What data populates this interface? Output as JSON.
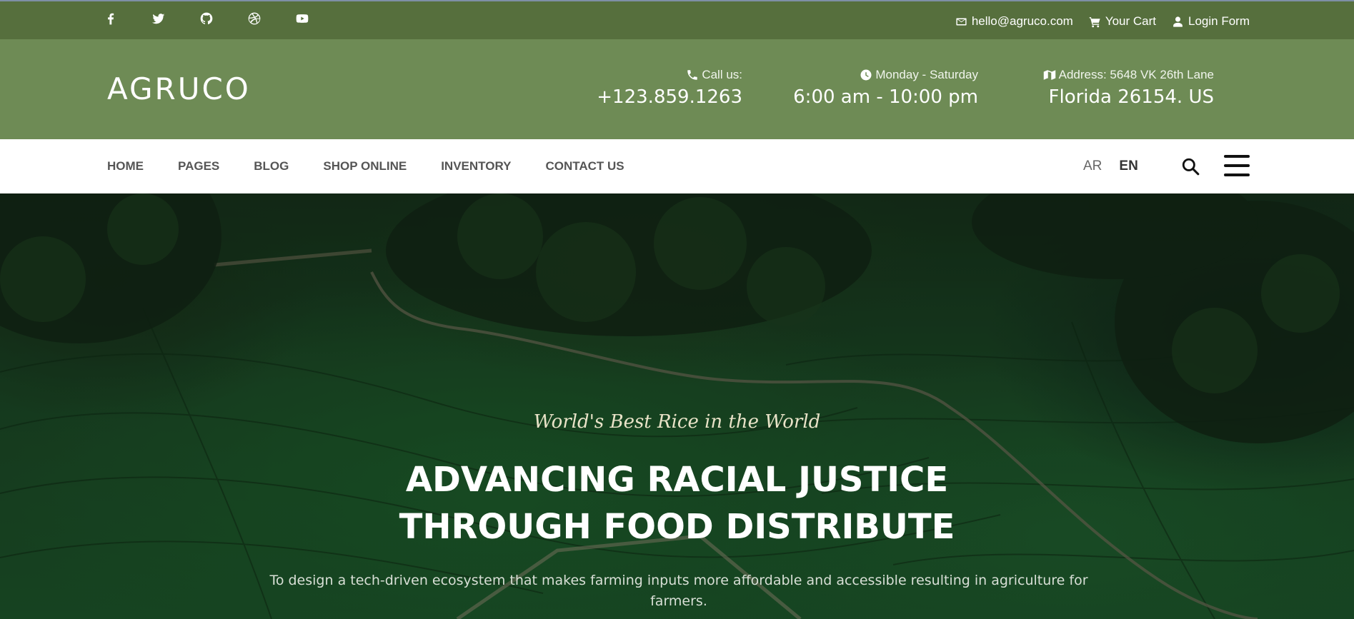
{
  "topbar": {
    "social": [
      {
        "name": "facebook-icon"
      },
      {
        "name": "twitter-icon"
      },
      {
        "name": "github-icon"
      },
      {
        "name": "dribbble-icon"
      },
      {
        "name": "youtube-icon"
      }
    ],
    "email": "hello@agruco.com",
    "cart": "Your Cart",
    "login": "Login Form"
  },
  "header": {
    "logo": "AGRUCO",
    "phone_label": "Call us:",
    "phone": "+123.859.1263",
    "hours_label": "Monday - Saturday",
    "hours": "6:00 am - 10:00 pm",
    "address_label": "Address: 5648 VK 26th Lane",
    "address": "Florida 26154. US"
  },
  "nav": {
    "items": [
      "HOME",
      "PAGES",
      "BLOG",
      "SHOP ONLINE",
      "INVENTORY",
      "CONTACT US"
    ],
    "lang_ar": "AR",
    "lang_en": "EN"
  },
  "hero": {
    "tagline": "World's Best Rice in the World",
    "headline_line1": "ADVANCING RACIAL JUSTICE",
    "headline_line2": "THROUGH FOOD DISTRIBUTE",
    "subtext": "To design a tech-driven ecosystem that makes farming inputs more affordable and accessible resulting in agriculture for farmers."
  },
  "colors": {
    "topbar": "#566f3d",
    "header": "#6e8b55",
    "nav_text": "#555555"
  }
}
